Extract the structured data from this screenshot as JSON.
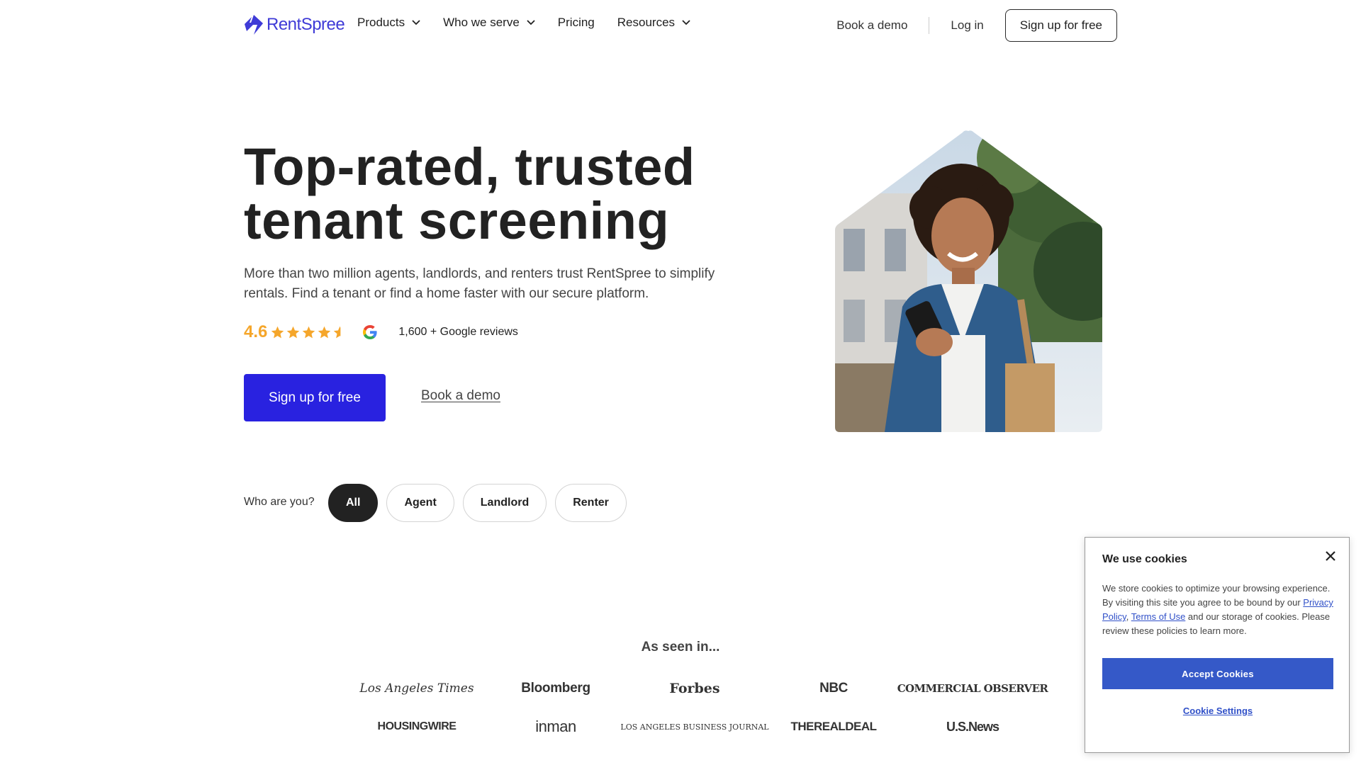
{
  "nav": {
    "logo_text": "RentSpree",
    "links": [
      {
        "label": "Products",
        "has_dropdown": true
      },
      {
        "label": "Who we serve",
        "has_dropdown": true
      },
      {
        "label": "Pricing",
        "has_dropdown": false
      },
      {
        "label": "Resources",
        "has_dropdown": true
      }
    ],
    "book_demo": "Book a demo",
    "login": "Log in",
    "signup": "Sign up for free"
  },
  "hero": {
    "title_line1": "Top-rated, trusted",
    "title_line2": "tenant screening",
    "subtitle": "More than two million agents, landlords, and renters trust RentSpree to simplify rentals. Find a tenant or find a home faster with our secure platform.",
    "rating": {
      "value": "4.6",
      "stars": 4.6,
      "reviews": "1,600 + Google reviews"
    },
    "cta_primary": "Sign up for free",
    "cta_secondary": "Book a demo"
  },
  "audience": {
    "label": "Who are you?",
    "options": [
      "All",
      "Agent",
      "Landlord",
      "Renter"
    ],
    "selected": "All"
  },
  "press": {
    "title": "As seen in...",
    "logos": [
      "Los Angeles Times",
      "Bloomberg",
      "Forbes",
      "NBC",
      "COMMERCIAL OBSERVER",
      "HOUSINGWIRE",
      "inman",
      "LOS ANGELES BUSINESS JOURNAL",
      "THEREALDEAL",
      "U.S.News"
    ]
  },
  "cookie": {
    "title": "We use cookies",
    "body_pre": "We store cookies to optimize your browsing experience. By visiting this site you agree to be bound by our ",
    "privacy_link": "Privacy Policy",
    "comma": ",",
    "terms_link": "Terms of Use",
    "body_post": " and our storage of cookies. Please review these policies to learn more.",
    "accept": "Accept Cookies",
    "settings": "Cookie Settings",
    "close_icon": "close-icon"
  },
  "colors": {
    "brand": "#2922e0",
    "star": "#f5a62b",
    "cookie_button": "#3559c8"
  }
}
